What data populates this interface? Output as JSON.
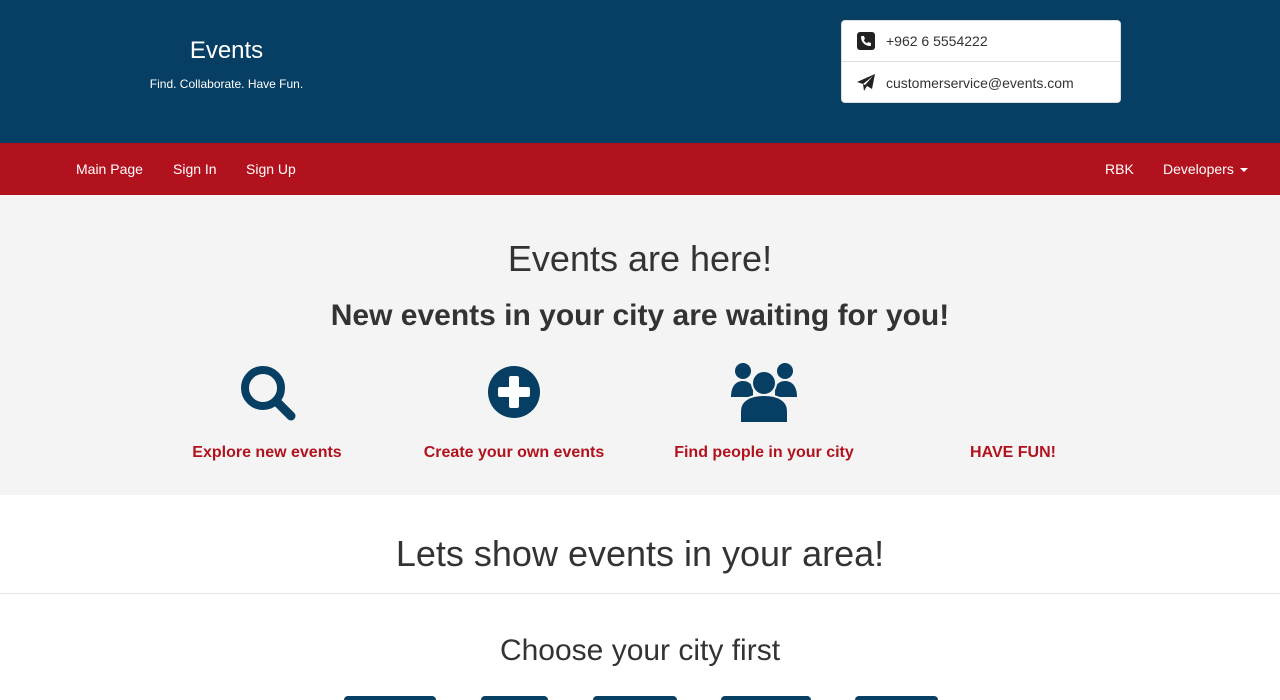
{
  "header": {
    "brand_title": "Events",
    "brand_tagline": "Find. Collaborate. Have Fun.",
    "contact": {
      "phone": "+962 6 5554222",
      "email": "customerservice@events.com"
    }
  },
  "nav": {
    "left": [
      "Main Page",
      "Sign In",
      "Sign Up"
    ],
    "right": [
      "RBK",
      "Developers"
    ]
  },
  "hero": {
    "title": "Events are here!",
    "subtitle": "New events in your city are waiting for you!",
    "features": [
      {
        "icon": "search-icon",
        "label": "Explore new events"
      },
      {
        "icon": "plus-circle-icon",
        "label": "Create your own events"
      },
      {
        "icon": "users-icon",
        "label": "Find people in your city"
      },
      {
        "icon": "",
        "label": "HAVE FUN!"
      }
    ]
  },
  "area": {
    "title": "Lets show events in your area!",
    "city_title": "Choose your city first"
  },
  "colors": {
    "header_bg": "#063f63",
    "navbar_bg": "#b2121e",
    "hero_bg": "#f4f4f4",
    "accent_red": "#b2121e",
    "icon_blue": "#063f63"
  }
}
